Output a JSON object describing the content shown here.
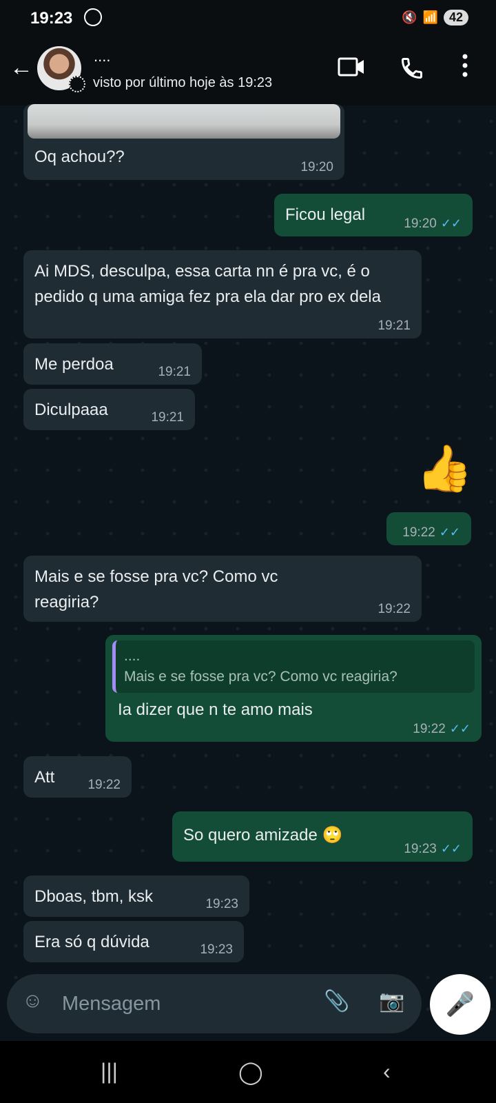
{
  "status": {
    "time": "19:23",
    "battery": "42"
  },
  "header": {
    "contact_name": "....",
    "last_seen": "visto por último hoje às 19:23"
  },
  "messages": [
    {
      "dir": "in",
      "text": "Oq achou??",
      "time": "19:20"
    },
    {
      "dir": "out",
      "text": "Ficou legal",
      "time": "19:20"
    },
    {
      "dir": "in",
      "text": "Ai MDS, desculpa, essa carta nn é pra vc, é o pedido q uma amiga fez pra ela dar pro ex dela",
      "time": "19:21"
    },
    {
      "dir": "in",
      "text": "Me perdoa",
      "time": "19:21"
    },
    {
      "dir": "in",
      "text": "Diculpaaa",
      "time": "19:21"
    },
    {
      "dir": "out",
      "text": "👍",
      "time": "19:22"
    },
    {
      "dir": "in",
      "text": "Mais e se fosse pra vc? Como vc reagiria?",
      "time": "19:22"
    },
    {
      "dir": "out",
      "reply_author": "....",
      "reply_text": "Mais e se fosse pra vc? Como vc reagiria?",
      "text": "Ia dizer que n te amo mais",
      "time": "19:22"
    },
    {
      "dir": "in",
      "text": "Att",
      "time": "19:22"
    },
    {
      "dir": "out",
      "text": "So quero amizade 🙄",
      "time": "19:23"
    },
    {
      "dir": "in",
      "text": "Dboas, tbm, ksk",
      "time": "19:23"
    },
    {
      "dir": "in",
      "text": "Era só q dúvida",
      "time": "19:23"
    }
  ],
  "input": {
    "placeholder": "Mensagem"
  },
  "colors": {
    "incoming": "#1f2c34",
    "outgoing": "#144d37",
    "read_tick": "#53bdeb"
  }
}
